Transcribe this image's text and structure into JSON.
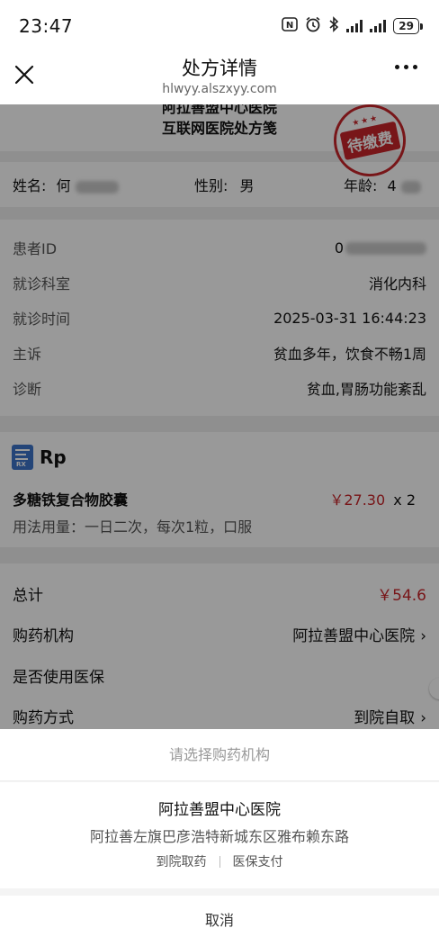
{
  "status_bar": {
    "time": "23:47",
    "battery": "29",
    "icons": [
      "nfc-icon",
      "alarm-icon",
      "bluetooth-icon",
      "signal-icon",
      "signal-icon",
      "battery-icon"
    ]
  },
  "nav": {
    "title": "处方详情",
    "url": "hlwyy.alszxyy.com",
    "close_icon": "close-icon",
    "more_icon": "more-icon"
  },
  "prescription": {
    "hospital_name": "阿拉善盟中心医院",
    "doc_title": "互联网医院处方笺",
    "stamp_text": "待缴费",
    "stamp_stars": "★★★",
    "stamp_color": "#c9252a"
  },
  "patient": {
    "name_label": "姓名:",
    "name_value": "何",
    "gender_label": "性别:",
    "gender_value": "男",
    "age_label": "年龄:",
    "age_value": "4"
  },
  "visit": {
    "rows": [
      {
        "label": "患者ID",
        "value": "0"
      },
      {
        "label": "就诊科室",
        "value": "消化内科"
      },
      {
        "label": "就诊时间",
        "value": "2025-03-31 16:44:23"
      },
      {
        "label": "主诉",
        "value": "贫血多年，饮食不畅1周"
      },
      {
        "label": "诊断",
        "value": "贫血,胃肠功能紊乱"
      }
    ]
  },
  "rp": {
    "icon": "rx-icon",
    "label": "Rp",
    "icon_text": "RX",
    "drug_name": "多糖铁复合物胶囊",
    "price": "￥27.30",
    "quantity": "x 2",
    "usage": "用法用量：一日二次，每次1粒，口服"
  },
  "summary": {
    "total_label": "总计",
    "total_value": "￥54.6",
    "pharmacy_label": "购药机构",
    "pharmacy_value": "阿拉善盟中心医院",
    "insurance_label": "是否使用医保",
    "insurance_on": false,
    "method_label": "购药方式",
    "method_value": "到院自取"
  },
  "sheet": {
    "title": "请选择购药机构",
    "option_name": "阿拉善盟中心医院",
    "option_address": "阿拉善左旗巴彦浩特新城东区雅布赖东路",
    "option_tag_1": "到院取药",
    "option_tag_2": "医保支付",
    "cancel_label": "取消"
  },
  "colors": {
    "accent_red": "#c9252a",
    "rx_blue": "#3d74c8"
  }
}
